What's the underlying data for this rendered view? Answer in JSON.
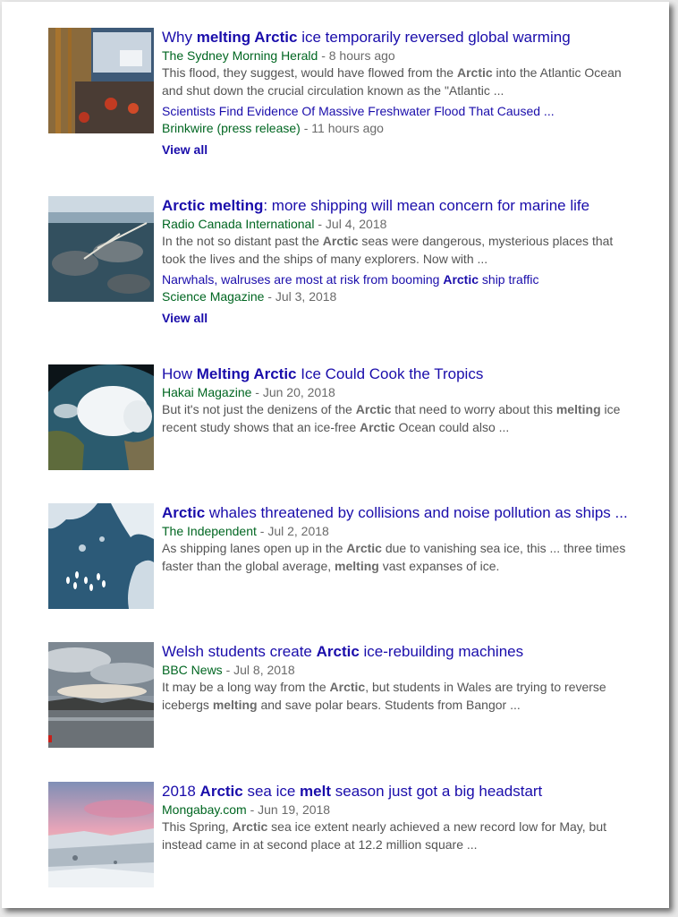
{
  "results": [
    {
      "title": [
        {
          "t": "Why "
        },
        {
          "t": "melting Arctic",
          "b": true
        },
        {
          "t": " ice temporarily reversed global warming"
        }
      ],
      "source": "The Sydney Morning Herald",
      "date": " - 8 hours ago",
      "snippet": [
        [
          {
            "t": "This flood, they suggest, would have flowed from the "
          },
          {
            "t": "Arctic",
            "b": true
          },
          {
            "t": " into the Atlantic Ocean"
          }
        ],
        [
          {
            "t": "and shut down the crucial circulation known as the \"Atlantic ..."
          }
        ]
      ],
      "thumbnail": "ship-deck-ice-photo",
      "related": {
        "title": [
          {
            "t": "Scientists Find Evidence Of Massive Freshwater Flood That Caused ..."
          }
        ],
        "source": "Brinkwire (press release)",
        "date": " - 11 hours ago"
      },
      "view_all": "View all"
    },
    {
      "title": [
        {
          "t": "Arctic melting",
          "b": true
        },
        {
          "t": ": more shipping will mean concern for marine life"
        }
      ],
      "source": "Radio Canada International",
      "date": " - Jul 4, 2018",
      "snippet": [
        [
          {
            "t": "In the not so distant past the "
          },
          {
            "t": "Arctic",
            "b": true
          },
          {
            "t": " seas were dangerous, mysterious places that"
          }
        ],
        [
          {
            "t": "took the lives and the ships of many explorers. Now with ..."
          }
        ]
      ],
      "thumbnail": "narwhals-photo",
      "related": {
        "title": [
          {
            "t": "Narwhals, walruses are most at risk from booming "
          },
          {
            "t": "Arctic",
            "b": true
          },
          {
            "t": " ship traffic"
          }
        ],
        "source": "Science Magazine",
        "date": " - Jul 3, 2018"
      },
      "view_all": "View all"
    },
    {
      "title": [
        {
          "t": "How "
        },
        {
          "t": "Melting Arctic",
          "b": true
        },
        {
          "t": " Ice Could Cook the Tropics"
        }
      ],
      "source": "Hakai Magazine",
      "date": " - Jun 20, 2018",
      "snippet": [
        [
          {
            "t": "But it's not just the denizens of the "
          },
          {
            "t": "Arctic",
            "b": true
          },
          {
            "t": " that need to worry about this "
          },
          {
            "t": "melting",
            "b": true
          },
          {
            "t": " ice"
          }
        ],
        [
          {
            "t": "recent study shows that an ice-free "
          },
          {
            "t": "Arctic",
            "b": true
          },
          {
            "t": " Ocean could also ..."
          }
        ]
      ],
      "thumbnail": "globe-arctic-photo"
    },
    {
      "title": [
        {
          "t": "Arctic",
          "b": true
        },
        {
          "t": " whales threatened by collisions and noise pollution as ships ..."
        }
      ],
      "source": "The Independent",
      "date": " - Jul 2, 2018",
      "snippet": [
        [
          {
            "t": "As shipping lanes open up in the "
          },
          {
            "t": "Arctic",
            "b": true
          },
          {
            "t": " due to vanishing sea ice, this ... three times"
          }
        ],
        [
          {
            "t": "faster than the global average, "
          },
          {
            "t": "melting",
            "b": true
          },
          {
            "t": " vast expanses of ice."
          }
        ]
      ],
      "thumbnail": "whales-aerial-photo"
    },
    {
      "title": [
        {
          "t": "Welsh students create "
        },
        {
          "t": "Arctic",
          "b": true
        },
        {
          "t": " ice-rebuilding machines"
        }
      ],
      "source": "BBC News",
      "date": " - Jul 8, 2018",
      "snippet": [
        [
          {
            "t": "It may be a long way from the "
          },
          {
            "t": "Arctic",
            "b": true
          },
          {
            "t": ", but students in Wales are trying to reverse"
          }
        ],
        [
          {
            "t": "icebergs "
          },
          {
            "t": "melting",
            "b": true
          },
          {
            "t": " and save polar bears. Students from Bangor ..."
          }
        ]
      ],
      "thumbnail": "landscape-clouds-photo"
    },
    {
      "title": [
        {
          "t": "2018 "
        },
        {
          "t": "Arctic",
          "b": true
        },
        {
          "t": " sea ice "
        },
        {
          "t": "melt",
          "b": true
        },
        {
          "t": " season just got a big headstart"
        }
      ],
      "source": "Mongabay.com",
      "date": " - Jun 19, 2018",
      "snippet": [
        [
          {
            "t": "This Spring, "
          },
          {
            "t": "Arctic",
            "b": true
          },
          {
            "t": " sea ice extent nearly achieved a new record low for May, but"
          }
        ],
        [
          {
            "t": "instead came in at second place at 12.2 million square ..."
          }
        ]
      ],
      "thumbnail": "sunset-ice-photo"
    }
  ]
}
